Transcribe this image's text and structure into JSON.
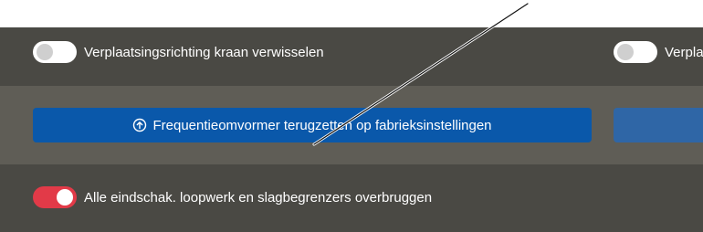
{
  "toggles": {
    "invert_crane_direction": {
      "label": "Verplaatsingsrichting kraan verwisselen",
      "state": "off"
    },
    "second_toggle": {
      "label": "Verpla",
      "state": "off"
    },
    "bypass_limits": {
      "label": "Alle eindschak. loopwerk en slagbegrenzers overbruggen",
      "state": "on"
    }
  },
  "buttons": {
    "reset_inverter": {
      "label": "Frequentieomvormer terugzetten op fabrieksinstellingen",
      "icon": "upload-circle-icon"
    }
  },
  "colors": {
    "dark_row": "#4a4944",
    "mid_row": "#5f5d56",
    "primary_button": "#0a58aa",
    "toggle_on": "#e23a48"
  }
}
